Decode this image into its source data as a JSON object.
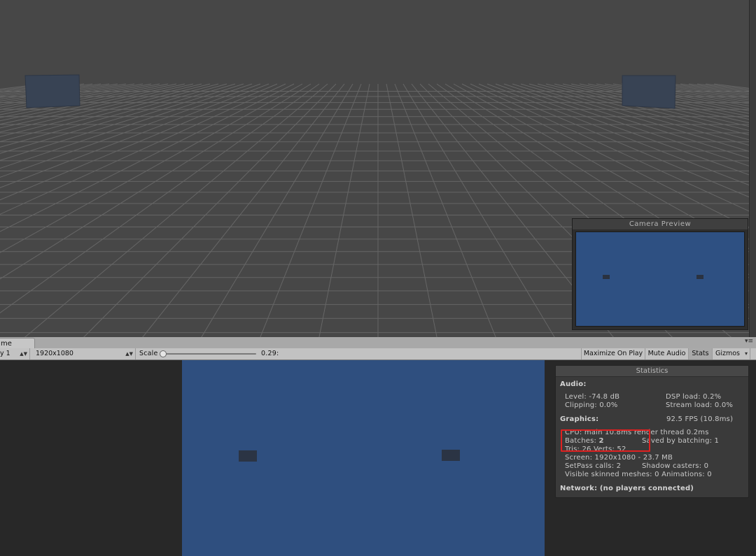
{
  "scene": {
    "camera_preview_title": "Camera Preview"
  },
  "tabs": {
    "game_tab": "me",
    "menu_glyph": "▾≡"
  },
  "toolbar": {
    "display": "y 1",
    "resolution": "1920x1080",
    "scale_label": "Scale",
    "scale_value": "0.29:",
    "scale_level": 0.0,
    "maximize_on_play": "Maximize On Play",
    "mute_audio": "Mute Audio",
    "stats": "Stats",
    "gizmos": "Gizmos",
    "dropdown_icon": "dropdown-arrow-icon"
  },
  "statistics": {
    "title": "Statistics",
    "audio": {
      "heading": "Audio:",
      "level": "Level: -74.8 dB",
      "clipping": "Clipping: 0.0%",
      "dsp_load": "DSP load: 0.2%",
      "stream_load": "Stream load: 0.0%"
    },
    "graphics": {
      "heading": "Graphics:",
      "fps": "92.5 FPS (10.8ms)",
      "cpu": "CPU: main 10.8ms  render thread 0.2ms",
      "batches_label": "Batches: ",
      "batches_value": "2",
      "saved_by_batching": "Saved by batching: 1",
      "tris_verts": "Tris: 26   Verts: 52",
      "screen": "Screen: 1920x1080 - 23.7 MB",
      "setpass": "SetPass calls: 2",
      "shadow_casters": "Shadow casters: 0",
      "visible_skinned": "Visible skinned meshes: 0  Animations: 0"
    },
    "network": "Network: (no players connected)"
  },
  "colors": {
    "scene_bg": "#474747",
    "grid_line": "#6a6a6a",
    "game_bg": "#2f4f7f",
    "highlight": "#e02020"
  }
}
